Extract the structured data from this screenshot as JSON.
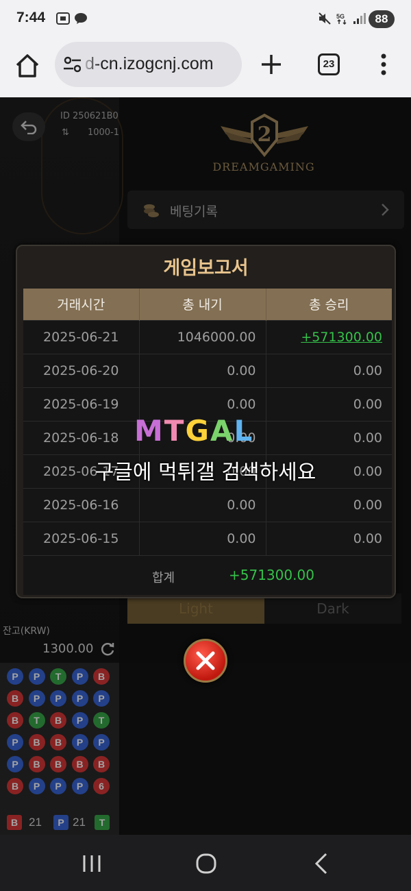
{
  "status_bar": {
    "time": "7:44",
    "battery": "88",
    "icons": [
      "screenshot-icon",
      "talk-icon",
      "mute-icon",
      "5g-icon",
      "signal-icon"
    ]
  },
  "browser": {
    "url": "d-cn.izogcnj.com",
    "tab_count": "23",
    "icons": [
      "home-icon",
      "site-settings-icon",
      "new-tab-icon",
      "tabs-icon",
      "menu-icon"
    ]
  },
  "game": {
    "id_text": "ID 250621B0",
    "limit_prefix": "⇅",
    "limit_value": "1000-1",
    "logo_text": "DREAMGAMING",
    "bet_record_label": "베팅기록",
    "theme_light": "Light",
    "theme_dark": "Dark",
    "balance_label": "잔고(KRW)",
    "balance_value": "1300.00",
    "road": [
      [
        "P",
        "B",
        "B",
        "P",
        "P",
        "B"
      ],
      [
        "P",
        "P",
        "T",
        "B",
        "B",
        "P"
      ],
      [
        "T",
        "P",
        "B",
        "B",
        "B",
        "P"
      ],
      [
        "P",
        "P",
        "P",
        "P",
        "B",
        "P"
      ],
      [
        "B",
        "P",
        "T",
        "P",
        "B",
        "6"
      ]
    ],
    "road_counts": {
      "b_label": "B",
      "b_count": "21",
      "p_label": "P",
      "p_count": "21",
      "t_label": "T"
    },
    "colors": {
      "banker": "#d42a2a",
      "player": "#2a5ad4",
      "tie": "#2aa03c",
      "accent": "#e8c48d"
    }
  },
  "report": {
    "title": "게임보고서",
    "headers": [
      "거래시간",
      "총 내기",
      "총 승리"
    ],
    "rows": [
      [
        "2025-06-21",
        "1046000.00",
        "+571300.00"
      ],
      [
        "2025-06-20",
        "0.00",
        "0.00"
      ],
      [
        "2025-06-19",
        "0.00",
        "0.00"
      ],
      [
        "2025-06-18",
        "0.00",
        "0.00"
      ],
      [
        "2025-06-17",
        "0.00",
        "0.00"
      ],
      [
        "2025-06-16",
        "0.00",
        "0.00"
      ],
      [
        "2025-06-15",
        "0.00",
        "0.00"
      ]
    ],
    "total_label": "합계",
    "total_value": "+571300.00"
  },
  "watermark": {
    "logo": "MTGAL",
    "text": "구글에 먹튀갤 검색하세요"
  },
  "nav": {
    "icons": [
      "recent-apps-icon",
      "home-circle-icon",
      "back-icon"
    ]
  }
}
